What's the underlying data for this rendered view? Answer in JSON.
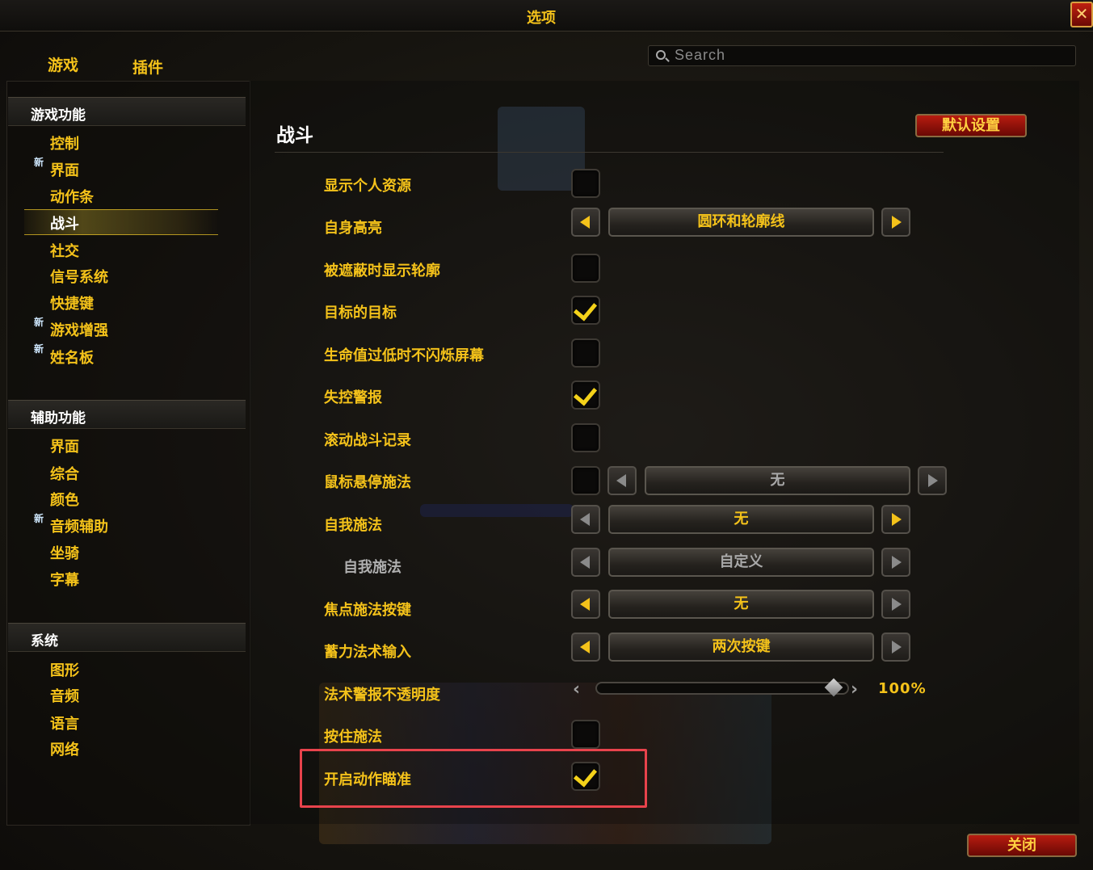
{
  "window": {
    "title": "选项",
    "close_glyph": "✕"
  },
  "tabs": [
    "游戏",
    "插件"
  ],
  "search": {
    "placeholder": "Search"
  },
  "sidebar": {
    "sections": [
      {
        "title": "游戏功能",
        "items": [
          {
            "label": "控制",
            "new": false,
            "selected": false
          },
          {
            "label": "界面",
            "new": true,
            "selected": false
          },
          {
            "label": "动作条",
            "new": false,
            "selected": false
          },
          {
            "label": "战斗",
            "new": false,
            "selected": true
          },
          {
            "label": "社交",
            "new": false,
            "selected": false
          },
          {
            "label": "信号系统",
            "new": false,
            "selected": false
          },
          {
            "label": "快捷键",
            "new": false,
            "selected": false
          },
          {
            "label": "游戏增强",
            "new": true,
            "selected": false
          },
          {
            "label": "姓名板",
            "new": true,
            "selected": false
          }
        ]
      },
      {
        "title": "辅助功能",
        "items": [
          {
            "label": "界面",
            "new": false
          },
          {
            "label": "综合",
            "new": false
          },
          {
            "label": "颜色",
            "new": false
          },
          {
            "label": "音频辅助",
            "new": true
          },
          {
            "label": "坐骑",
            "new": false
          },
          {
            "label": "字幕",
            "new": false
          }
        ]
      },
      {
        "title": "系统",
        "items": [
          {
            "label": "图形",
            "new": false
          },
          {
            "label": "音频",
            "new": false
          },
          {
            "label": "语言",
            "new": false
          },
          {
            "label": "网络",
            "new": false
          }
        ]
      }
    ],
    "new_badge": "新"
  },
  "main": {
    "title": "战斗",
    "defaults_button": "默认设置",
    "close_button": "关闭",
    "settings": [
      {
        "label": "显示个人资源",
        "type": "checkbox",
        "checked": false
      },
      {
        "label": "自身高亮",
        "type": "dropdown",
        "value": "圆环和轮廓线"
      },
      {
        "label": "被遮蔽时显示轮廓",
        "type": "checkbox",
        "checked": false
      },
      {
        "label": "目标的目标",
        "type": "checkbox",
        "checked": true
      },
      {
        "label": "生命值过低时不闪烁屏幕",
        "type": "checkbox",
        "checked": false
      },
      {
        "label": "失控警报",
        "type": "checkbox",
        "checked": true
      },
      {
        "label": "滚动战斗记录",
        "type": "checkbox",
        "checked": false
      },
      {
        "label": "鼠标悬停施法",
        "type": "checkbox+dropdown",
        "checked": false,
        "value": "无",
        "disabled": true
      },
      {
        "label": "自我施法",
        "type": "dropdown",
        "value": "无"
      },
      {
        "label": "自我施法",
        "type": "dropdown",
        "value": "自定义",
        "disabled": true,
        "indent": true
      },
      {
        "label": "焦点施法按键",
        "type": "dropdown",
        "value": "无"
      },
      {
        "label": "蓄力法术输入",
        "type": "dropdown",
        "value": "两次按键"
      },
      {
        "label": "法术警报不透明度",
        "type": "slider",
        "value": "100%",
        "level": 1.0
      },
      {
        "label": "按住施法",
        "type": "checkbox",
        "checked": false
      },
      {
        "label": "开启动作瞄准",
        "type": "checkbox",
        "checked": true,
        "highlighted": true
      }
    ]
  },
  "colors": {
    "accent": "#f4c21a",
    "highlight": "#e8434c",
    "button_red": "#b81c10"
  }
}
